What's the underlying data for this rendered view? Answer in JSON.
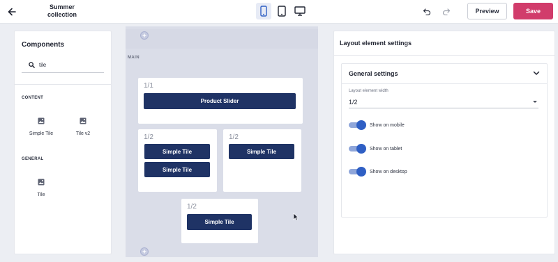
{
  "header": {
    "title": "Summer collection",
    "preview_label": "Preview",
    "save_label": "Save"
  },
  "components_panel": {
    "title": "Components",
    "search_value": "tile",
    "sections": [
      {
        "label": "CONTENT",
        "items": [
          {
            "label": "Simple Tile",
            "icon": "image-icon"
          },
          {
            "label": "Tile v2",
            "icon": "image-icon"
          }
        ]
      },
      {
        "label": "GENERAL",
        "items": [
          {
            "label": "Tile",
            "icon": "image-icon"
          }
        ]
      }
    ]
  },
  "canvas": {
    "section_label": "MAIN",
    "rows": [
      {
        "ratio": "1/1",
        "buttons": [
          "Product Slider"
        ]
      },
      {
        "ratio": "1/2",
        "buttons": [
          "Simple Tile",
          "Simple Tile"
        ]
      },
      {
        "ratio": "1/2",
        "buttons": [
          "Simple Tile"
        ]
      },
      {
        "ratio": "1/2",
        "buttons": [
          "Simple Tile"
        ]
      }
    ]
  },
  "settings_panel": {
    "title": "Layout element settings",
    "general_title": "General settings",
    "width_label": "Layout element width",
    "width_value": "1/2",
    "toggles": [
      {
        "label": "Show on mobile",
        "on": true
      },
      {
        "label": "Show on tablet",
        "on": true
      },
      {
        "label": "Show on desktop",
        "on": true
      }
    ]
  },
  "colors": {
    "accent_dark": "#1f3365",
    "save": "#d13c6b",
    "toggle": "#2f5fc4"
  }
}
